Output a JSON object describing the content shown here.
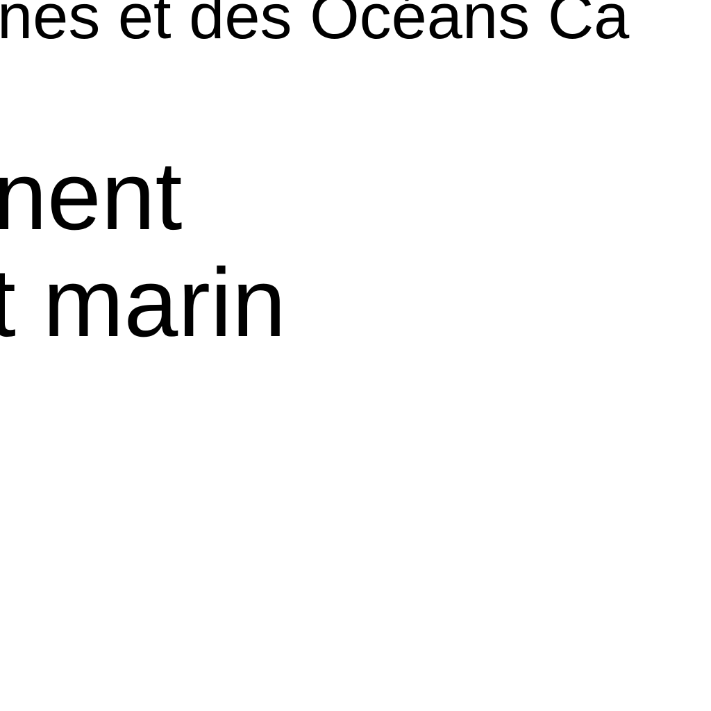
{
  "document": {
    "top_line": "nes et des Océans Ca",
    "heading_lines": [
      "nent",
      "t marin"
    ]
  }
}
